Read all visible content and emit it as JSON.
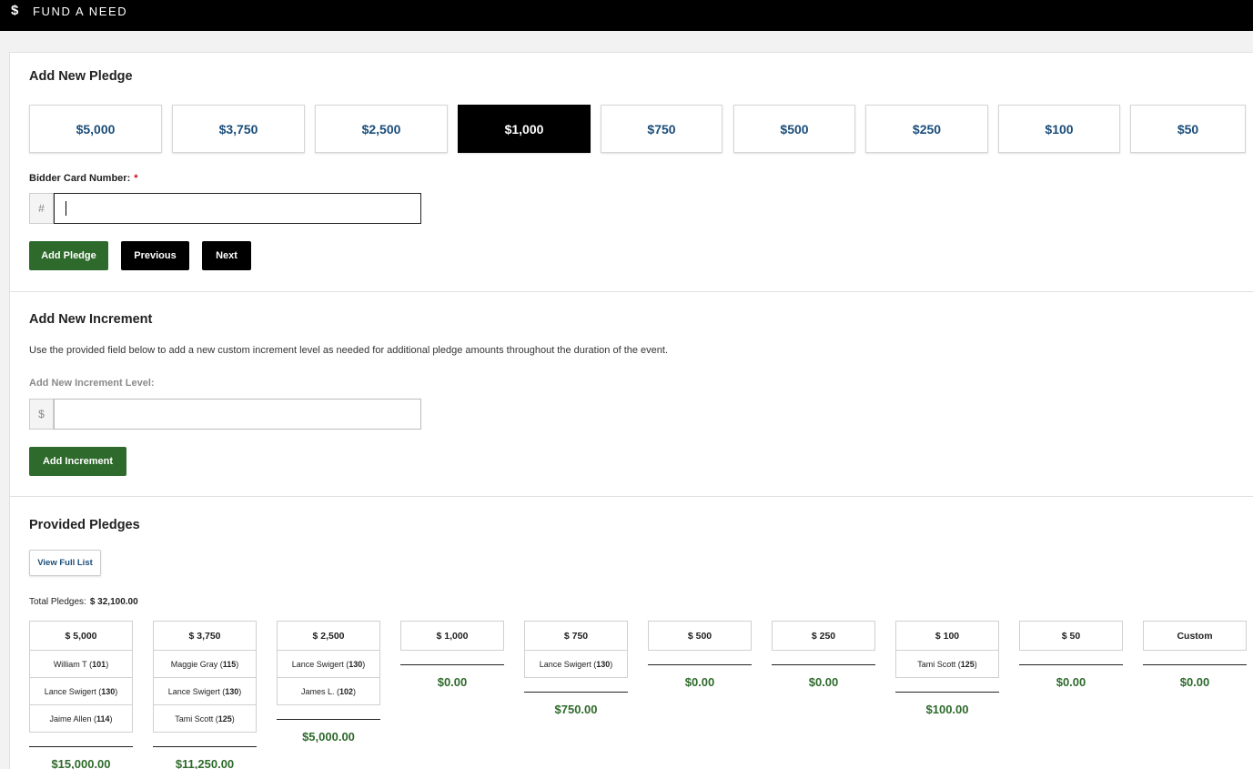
{
  "header": {
    "title": "FUND A NEED",
    "icon": "dollar-icon"
  },
  "add_pledge": {
    "heading": "Add New Pledge",
    "increments": [
      "$5,000",
      "$3,750",
      "$2,500",
      "$1,000",
      "$750",
      "$500",
      "$250",
      "$100",
      "$50"
    ],
    "selected": "$1,000",
    "bidder_label": "Bidder Card Number:",
    "required_mark": "*",
    "bidder_prefix": "#",
    "bidder_value": "",
    "buttons": {
      "add": "Add Pledge",
      "previous": "Previous",
      "next": "Next"
    }
  },
  "add_increment": {
    "heading": "Add New Increment",
    "description": "Use the provided field below to add a new custom increment level as needed for additional pledge amounts throughout the duration of the event.",
    "field_label": "Add New Increment Level:",
    "prefix": "$",
    "value": "",
    "button": "Add Increment"
  },
  "provided": {
    "heading": "Provided Pledges",
    "view_full_list": "View Full List",
    "total_label": "Total Pledges:",
    "total_value": "$ 32,100.00",
    "columns": [
      {
        "head": "$ 5,000",
        "pledges": [
          {
            "name": "William T",
            "num": "101"
          },
          {
            "name": "Lance Swigert",
            "num": "130"
          },
          {
            "name": "Jaime Allen",
            "num": "114"
          }
        ],
        "sum": "$15,000.00"
      },
      {
        "head": "$ 3,750",
        "pledges": [
          {
            "name": "Maggie Gray",
            "num": "115"
          },
          {
            "name": "Lance Swigert",
            "num": "130"
          },
          {
            "name": "Tami Scott",
            "num": "125"
          }
        ],
        "sum": "$11,250.00"
      },
      {
        "head": "$ 2,500",
        "pledges": [
          {
            "name": "Lance Swigert",
            "num": "130"
          },
          {
            "name": "James L.",
            "num": "102"
          }
        ],
        "sum": "$5,000.00"
      },
      {
        "head": "$ 1,000",
        "pledges": [],
        "sum": "$0.00"
      },
      {
        "head": "$ 750",
        "pledges": [
          {
            "name": "Lance Swigert",
            "num": "130"
          }
        ],
        "sum": "$750.00"
      },
      {
        "head": "$ 500",
        "pledges": [],
        "sum": "$0.00"
      },
      {
        "head": "$ 250",
        "pledges": [],
        "sum": "$0.00"
      },
      {
        "head": "$ 100",
        "pledges": [
          {
            "name": "Tami Scott",
            "num": "125"
          }
        ],
        "sum": "$100.00"
      },
      {
        "head": "$ 50",
        "pledges": [],
        "sum": "$0.00"
      },
      {
        "head": "Custom",
        "pledges": [],
        "sum": "$0.00"
      }
    ]
  },
  "colors": {
    "accent_green": "#2e6a2b",
    "link_blue": "#1a4d7a",
    "black": "#000000"
  }
}
